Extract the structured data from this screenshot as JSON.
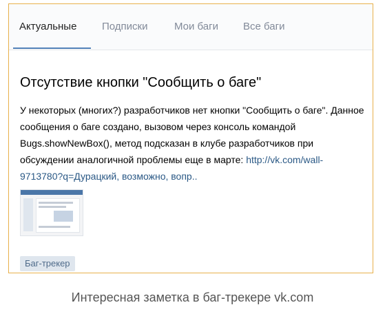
{
  "tabs": [
    {
      "label": "Актуальные",
      "active": true
    },
    {
      "label": "Подписки",
      "active": false
    },
    {
      "label": "Мои баги",
      "active": false
    },
    {
      "label": "Все баги",
      "active": false
    }
  ],
  "post": {
    "title": "Отсутствие кнопки \"Сообщить о баге\"",
    "text": "У некоторых (многих?) разработчиков нет кнопки \"Сообщить о баге\". Данное сообщения о баге создано, вызовом через консоль командой Bugs.showNewBox(), метод подсказан в клубе разработчиков при обсуждении аналогичной проблемы еще в марте: ",
    "link": "http://vk.com/wall-9713780?q=Дурацкий, возможно, вопр..",
    "thumbnail_icon": "screenshot-thumbnail",
    "tag": "Баг-трекер"
  },
  "caption": "Интересная заметка в баг-трекере vk.com",
  "colors": {
    "accent": "#5181b8",
    "link": "#2a5885",
    "frame_border": "#e8b04a",
    "tag_bg": "#dfe6ee"
  }
}
